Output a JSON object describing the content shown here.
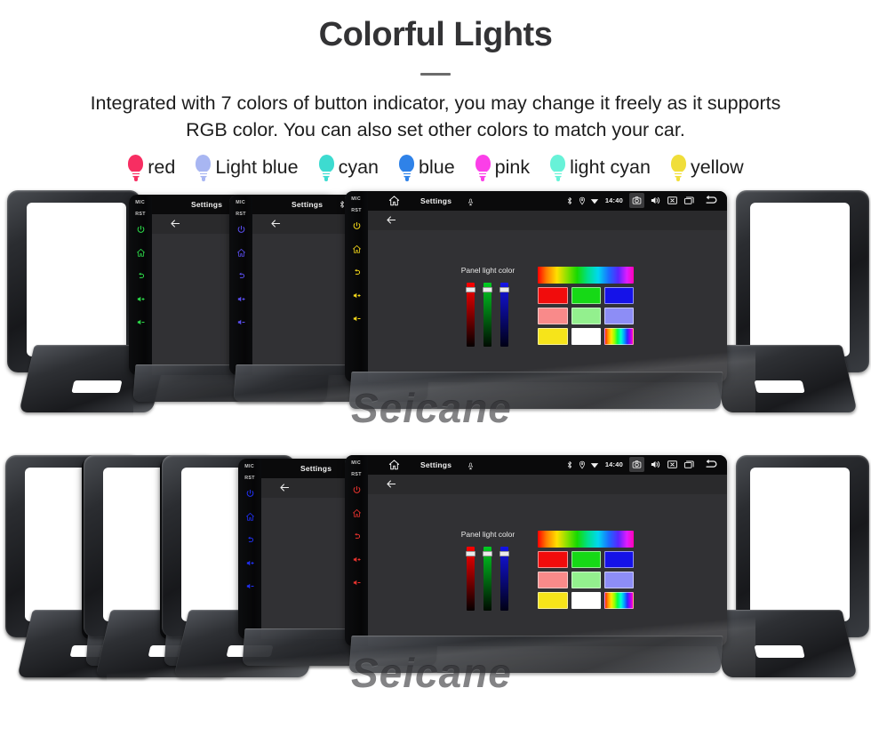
{
  "header": {
    "title": "Colorful Lights",
    "subtitle": "Integrated with 7 colors of button indicator, you may change it freely as it supports RGB color. You can also set other colors to match your car."
  },
  "legend": {
    "items": [
      {
        "label": "red",
        "color": "#f72e62",
        "icon": "bulb-icon"
      },
      {
        "label": "Light blue",
        "color": "#a8b6f2",
        "icon": "bulb-icon"
      },
      {
        "label": "cyan",
        "color": "#3ddbd0",
        "icon": "bulb-icon"
      },
      {
        "label": "blue",
        "color": "#2f82e8",
        "icon": "bulb-icon"
      },
      {
        "label": "pink",
        "color": "#fb3fe8",
        "icon": "bulb-icon"
      },
      {
        "label": "light cyan",
        "color": "#68f2d8",
        "icon": "bulb-icon"
      },
      {
        "label": "yellow",
        "color": "#f0de3a",
        "icon": "bulb-icon"
      }
    ]
  },
  "screen": {
    "statusbar": {
      "home_icon": "home-icon",
      "title": "Settings",
      "mic_icon": "mic-icon",
      "bluetooth_icon": "bluetooth-icon",
      "location_icon": "location-pin-icon",
      "wifi_icon": "wifi-icon",
      "time": "14:40",
      "camera_icon": "camera-icon",
      "volume_icon": "volume-icon",
      "close_icon": "close-box-icon",
      "recents_icon": "recent-apps-icon",
      "back_icon": "back-arrow-icon"
    },
    "appbar": {
      "back_icon": "back-arrow-icon"
    },
    "settings": {
      "panel_label": "Panel light color",
      "sliders": [
        {
          "name": "red-channel-slider",
          "top": "#ff0000",
          "bottom": "#050000",
          "value_pct": 92
        },
        {
          "name": "green-channel-slider",
          "top": "#00cc22",
          "bottom": "#000b02",
          "value_pct": 92
        },
        {
          "name": "blue-channel-slider",
          "top": "#1414e6",
          "bottom": "#000014",
          "value_pct": 92
        }
      ],
      "rainbow_bar": "rainbow-gradient-bar",
      "swatches": [
        [
          {
            "name": "swatch-red",
            "color": "#f10c0c"
          },
          {
            "name": "swatch-green",
            "color": "#16d916"
          },
          {
            "name": "swatch-blue",
            "color": "#1512e8"
          }
        ],
        [
          {
            "name": "swatch-salmon",
            "color": "#f98a8a"
          },
          {
            "name": "swatch-lightgreen",
            "color": "#93f08e"
          },
          {
            "name": "swatch-periwinkle",
            "color": "#8d8df6"
          }
        ],
        [
          {
            "name": "swatch-yellow",
            "color": "#f6e41a"
          },
          {
            "name": "swatch-white",
            "color": "#ffffff"
          },
          {
            "name": "swatch-rainbow",
            "color": "rainbow"
          }
        ]
      ]
    },
    "side_buttons": {
      "mic_label": "MIC",
      "rst_label": "RST",
      "icons": [
        "power-icon",
        "home-icon",
        "back-icon",
        "volume-up-icon",
        "volume-down-icon"
      ]
    }
  },
  "watermark": {
    "text": "Seicane"
  },
  "rows": [
    {
      "name": "product-row-top",
      "units": [
        {
          "name": "head-unit-green",
          "led_color": "#2cdd4a"
        },
        {
          "name": "head-unit-violet",
          "led_color": "#5a4ef0"
        },
        {
          "name": "head-unit-yellow",
          "led_color": "#f4d81a"
        }
      ]
    },
    {
      "name": "product-row-bottom",
      "units": [
        {
          "name": "head-unit-red",
          "led_color": "#f01c1c"
        },
        {
          "name": "head-unit-green",
          "led_color": "#2cdd4a"
        },
        {
          "name": "head-unit-blue",
          "led_color": "#2030f5"
        },
        {
          "name": "head-unit-red-2",
          "led_color": "#e8332e"
        }
      ]
    }
  ]
}
